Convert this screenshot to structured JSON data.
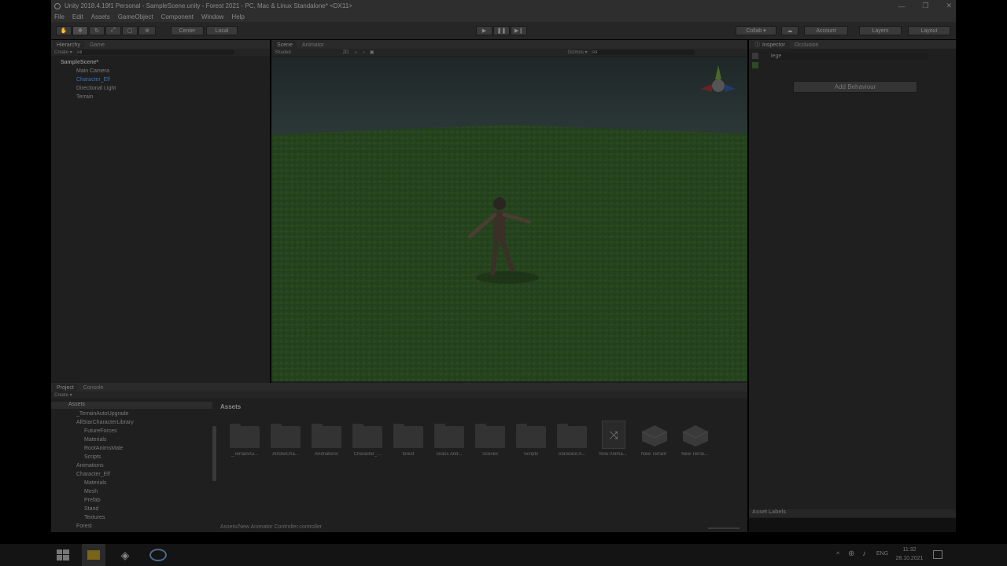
{
  "window": {
    "title": "Unity 2018.4.19f1 Personal - SampleScene.unity - Forest 2021 - PC, Mac & Linux Standalone* <DX11>",
    "buttons": [
      "—",
      "❐",
      "✕"
    ]
  },
  "menu": [
    "File",
    "Edit",
    "Assets",
    "GameObject",
    "Component",
    "Window",
    "Help"
  ],
  "toolbar": {
    "center": "Center",
    "local": "Local",
    "collab": "Collab ▾",
    "account": "Account",
    "layers": "Layers",
    "layout": "Layout"
  },
  "hierarchy": {
    "tabs": [
      "Hierarchy",
      "Game"
    ],
    "create": "Create ▾",
    "search_placeholder": "All",
    "scene": "SampleScene*",
    "items": [
      "Main Camera",
      "Character_Elf",
      "Directional Light",
      "Terrain"
    ]
  },
  "scene": {
    "tabs": [
      "Scene",
      "Animator"
    ],
    "shading": "Shaded",
    "mode_2d": "2D",
    "gizmos": "Gizmos ▾",
    "search_placeholder": "All"
  },
  "inspector": {
    "tabs": [
      "Inspector",
      "Occlusion"
    ],
    "name_field": "lege",
    "add_behaviour": "Add Behaviour",
    "asset_labels": "Asset Labels"
  },
  "project": {
    "tabs": [
      "Project",
      "Console"
    ],
    "create": "Create ▾",
    "root": "Assets",
    "tree": [
      {
        "label": "_TerrainAutoUpgrade",
        "indent": 1
      },
      {
        "label": "AllStarCharacterLibrary",
        "indent": 1
      },
      {
        "label": "FutureForces",
        "indent": 2
      },
      {
        "label": "Materials",
        "indent": 2
      },
      {
        "label": "RootAnimsMale",
        "indent": 2
      },
      {
        "label": "Scripts",
        "indent": 2
      },
      {
        "label": "Animations",
        "indent": 1
      },
      {
        "label": "Character_Elf",
        "indent": 1
      },
      {
        "label": "Materials",
        "indent": 2
      },
      {
        "label": "Mesh",
        "indent": 2
      },
      {
        "label": "Prefab",
        "indent": 2
      },
      {
        "label": "Stand",
        "indent": 2
      },
      {
        "label": "Textures",
        "indent": 2
      },
      {
        "label": "Forest",
        "indent": 1
      }
    ],
    "breadcrumb": "Assets",
    "assets": [
      "_TerrainAu...",
      "AllStarCha...",
      "Animations",
      "Character_...",
      "forest",
      "Grass And...",
      "Scenes",
      "Scripts",
      "Standard A...",
      "New Anima...",
      "New Terrain",
      "New Terrai..."
    ],
    "status_path": "Assets/New Animator Controller.controller"
  },
  "taskbar": {
    "lang": "ENG",
    "time": "11:32",
    "date": "28.10.2021"
  }
}
